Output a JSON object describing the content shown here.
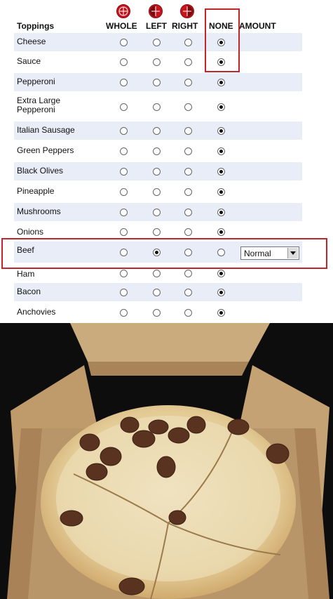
{
  "headers": {
    "toppings": "Toppings",
    "whole": "WHOLE",
    "left": "LEFT",
    "right": "RIGHT",
    "none": "NONE",
    "amount": "AMOUNT"
  },
  "toppings": [
    {
      "label": "Cheese",
      "selected": "none"
    },
    {
      "label": "Sauce",
      "selected": "none"
    },
    {
      "label": "Pepperoni",
      "selected": "none"
    },
    {
      "label": "Extra Large Pepperoni",
      "selected": "none"
    },
    {
      "label": "Italian Sausage",
      "selected": "none"
    },
    {
      "label": "Green Peppers",
      "selected": "none"
    },
    {
      "label": "Black Olives",
      "selected": "none"
    },
    {
      "label": "Pineapple",
      "selected": "none"
    },
    {
      "label": "Mushrooms",
      "selected": "none"
    },
    {
      "label": "Onions",
      "selected": "none"
    },
    {
      "label": "Beef",
      "selected": "left"
    },
    {
      "label": "Ham",
      "selected": "none"
    },
    {
      "label": "Bacon",
      "selected": "none"
    },
    {
      "label": "Anchovies",
      "selected": "none"
    }
  ],
  "beef_amount": {
    "value": "Normal"
  },
  "colors": {
    "highlight_red": "#c0272d",
    "row_alt": "#e8edf8",
    "pie_red": "#c8141c",
    "box_cardboard": "#b8966a",
    "crust": "#e9d6a8",
    "beef": "#5a3320"
  },
  "photo": {
    "subject": "pizza-in-box-with-beef-on-left-half"
  }
}
